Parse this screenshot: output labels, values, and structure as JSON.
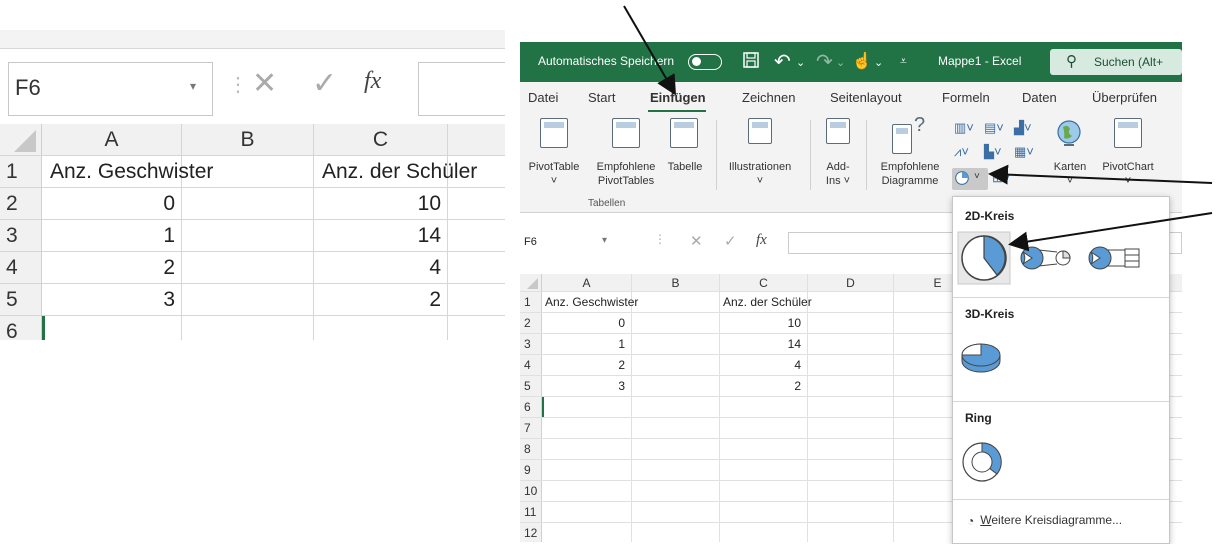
{
  "left_zoom": {
    "name_box": "F6",
    "fx_cancel": "✕",
    "fx_ok": "✓",
    "fx_label": "fx",
    "columns": [
      "A",
      "B",
      "C"
    ],
    "rows": [
      {
        "num": "1",
        "a": "Anz. Geschwister",
        "c": "Anz. der Schüler"
      },
      {
        "num": "2",
        "a": "0",
        "c": "10"
      },
      {
        "num": "3",
        "a": "1",
        "c": "14"
      },
      {
        "num": "4",
        "a": "2",
        "c": "4"
      },
      {
        "num": "5",
        "a": "3",
        "c": "2"
      },
      {
        "num": "6",
        "a": "",
        "c": ""
      }
    ]
  },
  "titlebar": {
    "autosave": "Automatisches Speichern",
    "doc_title": "Mappe1  -  Excel",
    "search_placeholder": "Suchen (Alt+"
  },
  "menu_tabs": [
    "Datei",
    "Start",
    "Einfügen",
    "Zeichnen",
    "Seitenlayout",
    "Formeln",
    "Daten",
    "Überprüfen"
  ],
  "ribbon": {
    "pivot_table": "PivotTable",
    "recommended_pivot_line1": "Empfohlene",
    "recommended_pivot_line2": "PivotTables",
    "table": "Tabelle",
    "group_tables": "Tabellen",
    "illustrations": "Illustrationen",
    "addins_line1": "Add-",
    "addins_line2": "Ins ˅",
    "recommended_charts_line1": "Empfohlene",
    "recommended_charts_line2": "Diagramme",
    "maps": "Karten",
    "pivot_chart": "PivotChart"
  },
  "right_sheet": {
    "name_box": "F6",
    "fx_label": "fx",
    "columns": [
      "A",
      "B",
      "C",
      "D",
      "E"
    ],
    "rows": [
      {
        "num": "1",
        "a": "Anz. Geschwister",
        "c": "Anz. der Schüler"
      },
      {
        "num": "2",
        "a": "0",
        "c": "10"
      },
      {
        "num": "3",
        "a": "1",
        "c": "14"
      },
      {
        "num": "4",
        "a": "2",
        "c": "4"
      },
      {
        "num": "5",
        "a": "3",
        "c": "2"
      },
      {
        "num": "6",
        "a": "",
        "c": ""
      },
      {
        "num": "7",
        "a": "",
        "c": ""
      },
      {
        "num": "8",
        "a": "",
        "c": ""
      },
      {
        "num": "9",
        "a": "",
        "c": ""
      },
      {
        "num": "10",
        "a": "",
        "c": ""
      },
      {
        "num": "11",
        "a": "",
        "c": ""
      },
      {
        "num": "12",
        "a": "",
        "c": ""
      }
    ]
  },
  "pie_menu": {
    "section_2d": "2D-Kreis",
    "section_3d": "3D-Kreis",
    "section_ring": "Ring",
    "more_underlined": "W",
    "more_rest": "eitere Kreisdiagramme..."
  },
  "colors": {
    "excel_green": "#217346",
    "pie_blue": "#5b9bd5"
  }
}
